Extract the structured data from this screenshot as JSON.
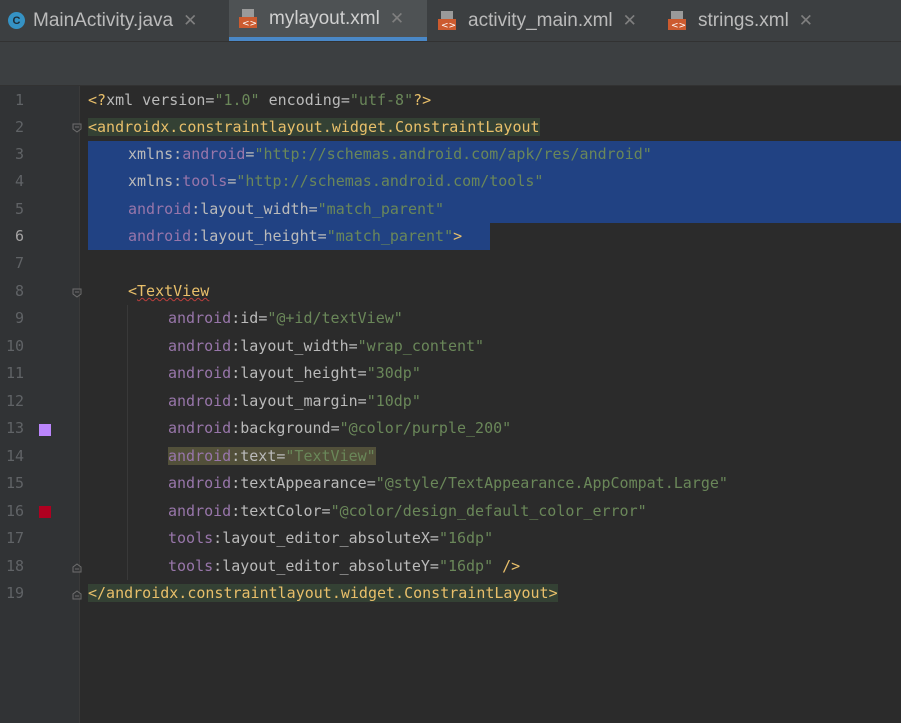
{
  "tabs": [
    {
      "label": "MainActivity.java",
      "icon": "java-class-icon",
      "active": false
    },
    {
      "label": "mylayout.xml",
      "icon": "xml-file-icon",
      "active": true
    },
    {
      "label": "activity_main.xml",
      "icon": "xml-file-icon",
      "active": false
    },
    {
      "label": "strings.xml",
      "icon": "xml-file-icon",
      "active": false
    }
  ],
  "close_glyph": "✕",
  "line_numbers": [
    "1",
    "2",
    "3",
    "4",
    "5",
    "6",
    "7",
    "8",
    "9",
    "10",
    "11",
    "12",
    "13",
    "14",
    "15",
    "16",
    "17",
    "18",
    "19"
  ],
  "current_line": "6",
  "gutter_colors": {
    "line13": "#bb86fc",
    "line16": "#b00020"
  },
  "code": {
    "l1": [
      "<?",
      "xml version",
      "=",
      "\"1.0\"",
      " encoding",
      "=",
      "\"utf-8\"",
      "?>"
    ],
    "l2": [
      "<androidx.constraintlayout.widget.ConstraintLayout"
    ],
    "l3": [
      "xmlns",
      ":",
      "android",
      "=",
      "\"http://schemas.android.com/apk/res/android\""
    ],
    "l4": [
      "xmlns",
      ":",
      "tools",
      "=",
      "\"http://schemas.android.com/tools\""
    ],
    "l5": [
      "android",
      ":",
      "layout_width",
      "=",
      "\"match_parent\""
    ],
    "l6": [
      "android",
      ":",
      "layout_height",
      "=",
      "\"match_parent\"",
      ">"
    ],
    "l8": [
      "<",
      "TextView"
    ],
    "l9": [
      "android",
      ":",
      "id",
      "=",
      "\"@+id/textView\""
    ],
    "l10": [
      "android",
      ":",
      "layout_width",
      "=",
      "\"wrap_content\""
    ],
    "l11": [
      "android",
      ":",
      "layout_height",
      "=",
      "\"30dp\""
    ],
    "l12": [
      "android",
      ":",
      "layout_margin",
      "=",
      "\"10dp\""
    ],
    "l13": [
      "android",
      ":",
      "background",
      "=",
      "\"@color/purple_200\""
    ],
    "l14": [
      "android",
      ":",
      "text",
      "=",
      "\"TextView\""
    ],
    "l15": [
      "android",
      ":",
      "textAppearance",
      "=",
      "\"@style/TextAppearance.AppCompat.Large\""
    ],
    "l16": [
      "android",
      ":",
      "textColor",
      "=",
      "\"@color/design_default_color_error\""
    ],
    "l17": [
      "tools",
      ":",
      "layout_editor_absoluteX",
      "=",
      "\"16dp\""
    ],
    "l18": [
      "tools",
      ":",
      "layout_editor_absoluteY",
      "=",
      "\"16dp\"",
      " />"
    ],
    "l19": [
      "</androidx.constraintlayout.widget.ConstraintLayout>"
    ]
  },
  "colors": {
    "background": "#2b2b2b",
    "tag": "#e8bf6a",
    "namespace": "#9876aa",
    "string": "#6a8759",
    "selection": "#214283",
    "active_tab_underline": "#4a88c7"
  }
}
